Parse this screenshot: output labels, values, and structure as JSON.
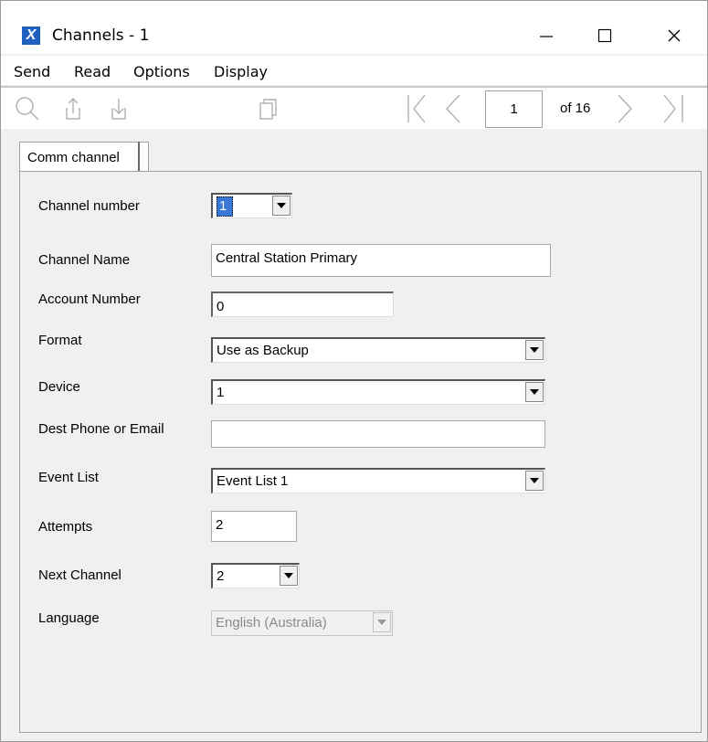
{
  "window": {
    "title": "Channels - 1",
    "app_icon": "X"
  },
  "window_controls": {
    "minimize": "—",
    "maximize": "☐",
    "close": "✕"
  },
  "menu": {
    "items": [
      "Send",
      "Read",
      "Options",
      "Display"
    ]
  },
  "pager": {
    "current_page": "1",
    "of_label": "of 16"
  },
  "tabs": [
    "Comm channel"
  ],
  "form": {
    "channel_number": {
      "label": "Channel number",
      "value": "1"
    },
    "channel_name": {
      "label": "Channel Name",
      "value": "Central Station Primary"
    },
    "account_number": {
      "label": "Account Number",
      "value": "0"
    },
    "format": {
      "label": "Format",
      "value": "Use as Backup"
    },
    "device": {
      "label": "Device",
      "value": "1"
    },
    "dest": {
      "label": "Dest Phone or Email",
      "value": ""
    },
    "event_list": {
      "label": "Event List",
      "value": "Event List 1"
    },
    "attempts": {
      "label": "Attempts",
      "value": "2"
    },
    "next_channel": {
      "label": "Next Channel",
      "value": "2"
    },
    "language": {
      "label": "Language",
      "value": "English (Australia)"
    }
  },
  "colors": {
    "app_icon_bg": "#1f5fbf",
    "selection": "#3a78d6"
  }
}
